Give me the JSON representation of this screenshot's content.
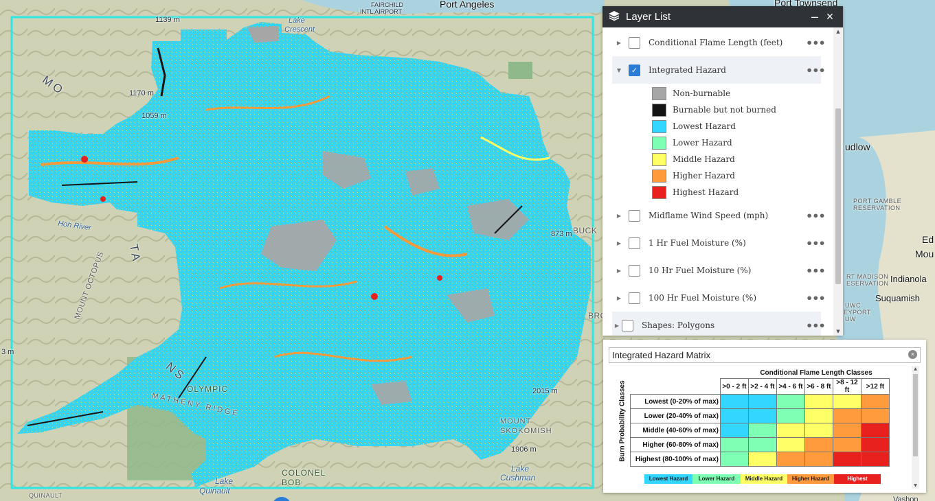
{
  "map": {
    "labels": {
      "fairchild": "FAIRCHILD",
      "intl_airport": "INTL AIRPORT",
      "port_angeles": "Port Angeles",
      "port_townsend": "Port Townsend",
      "lake_crescent_1": "Lake",
      "lake_crescent_2": "Crescent",
      "elev_1139": "1139 m",
      "elev_1170": "1170 m",
      "elev_1059": "1059 m",
      "elev_873": "873 m",
      "elev_2015": "2015 m",
      "elev_1906": "1906 m",
      "elev_3": "3 m",
      "hoh_river": "Hoh River",
      "mount_octopus": "MOUNT OCTOPUS",
      "olympic": "OLYMPIC",
      "matheny_ridge": "MATHENY RIDGE",
      "colonel_bob_1": "COLONEL",
      "colonel_bob_2": "BOB",
      "mount_skokomish_1": "MOUNT",
      "mount_skokomish_2": "SKOKOMISH",
      "lake_cushman_1": "Lake",
      "lake_cushman_2": "Cushman",
      "lake_quinault_1": "Lake",
      "lake_quinault_2": "Quinault",
      "quinault": "QUINAULT",
      "quilcene": "udlow",
      "port_gamble_1": "PORT GAMBLE",
      "port_gamble_2": "RESERVATION",
      "port_madison_1": "RT MADISON",
      "port_madison_2": "ESERVATION",
      "indianola": "Indianola",
      "suquamish": "Suquamish",
      "uwc_1": "UWC",
      "uwc_2": "EYPORT",
      "uwc_3": "UW",
      "edm_1": "Ed",
      "edm_2": "Mou",
      "buck": "BUCK",
      "bro": "BRO",
      "vashon": "Vashon",
      "mo": "MO",
      "ta": "TA",
      "ns": "NS"
    }
  },
  "layer_list": {
    "title": "Layer List",
    "minimize": "–",
    "close": "×",
    "layers": [
      {
        "label": "Conditional Flame Length (feet)",
        "checked": false
      },
      {
        "label": "Integrated Hazard",
        "checked": true
      },
      {
        "label": "Midflame Wind Speed (mph)",
        "checked": false
      },
      {
        "label": "1 Hr Fuel Moisture (%)",
        "checked": false
      },
      {
        "label": "10 Hr Fuel Moisture (%)",
        "checked": false
      },
      {
        "label": "100 Hr Fuel Moisture (%)",
        "checked": false
      },
      {
        "label": "Shapes: Polygons",
        "checked": false
      }
    ],
    "more": "•••",
    "legend": [
      {
        "label": "Non-burnable",
        "color": "#a6a6a6"
      },
      {
        "label": "Burnable but not burned",
        "color": "#141414"
      },
      {
        "label": "Lowest Hazard",
        "color": "#33d6ff"
      },
      {
        "label": "Lower Hazard",
        "color": "#7dffb4"
      },
      {
        "label": "Middle Hazard",
        "color": "#ffff66"
      },
      {
        "label": "Higher Hazard",
        "color": "#ff9a3d"
      },
      {
        "label": "Highest Hazard",
        "color": "#e8211f"
      }
    ]
  },
  "matrix": {
    "title": "Integrated Hazard Matrix",
    "close": "×",
    "col_title": "Conditional Flame Length Classes",
    "row_title": "Burn Probability Classes",
    "columns": [
      ">0 - 2 ft",
      ">2 - 4 ft",
      ">4 - 6 ft",
      ">6 - 8 ft",
      ">8 - 12 ft",
      ">12 ft"
    ],
    "rows": [
      {
        "label": "Lowest (0-20% of max)",
        "cells": [
          "#33d6ff",
          "#33d6ff",
          "#7dffb4",
          "#ffff66",
          "#ffff66",
          "#ff9a3d"
        ]
      },
      {
        "label": "Lower (20-40% of max)",
        "cells": [
          "#33d6ff",
          "#33d6ff",
          "#7dffb4",
          "#ffff66",
          "#ff9a3d",
          "#ff9a3d"
        ]
      },
      {
        "label": "Middle (40-60% of max)",
        "cells": [
          "#33d6ff",
          "#7dffb4",
          "#ffff66",
          "#ffff66",
          "#ff9a3d",
          "#e8211f"
        ]
      },
      {
        "label": "Higher (60-80% of max)",
        "cells": [
          "#7dffb4",
          "#7dffb4",
          "#ffff66",
          "#ff9a3d",
          "#ff9a3d",
          "#e8211f"
        ]
      },
      {
        "label": "Highest (80-100% of max)",
        "cells": [
          "#7dffb4",
          "#ffff66",
          "#ff9a3d",
          "#ff9a3d",
          "#e8211f",
          "#e8211f"
        ]
      }
    ],
    "key": [
      {
        "label": "Lowest Hazard",
        "color": "#33d6ff",
        "text": "#1a1a1a"
      },
      {
        "label": "Lower Hazard",
        "color": "#7dffb4",
        "text": "#1a1a1a"
      },
      {
        "label": "Middle Hazard",
        "color": "#ffff66",
        "text": "#1a1a1a"
      },
      {
        "label": "Higher Hazard",
        "color": "#ff9a3d",
        "text": "#1a1a1a"
      },
      {
        "label": "Highest Hazard",
        "color": "#e8211f",
        "text": "#ffffff"
      }
    ]
  }
}
